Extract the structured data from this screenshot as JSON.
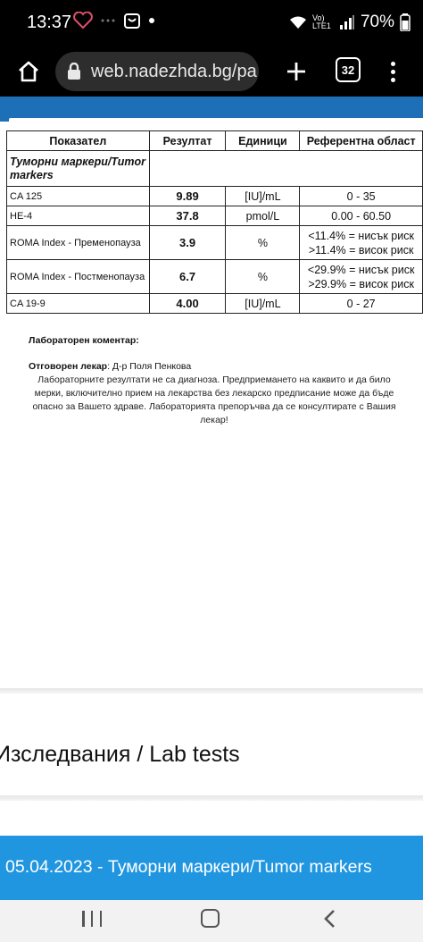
{
  "status_bar": {
    "time": "13:37",
    "battery": "70%",
    "network": "Vo) LTE1"
  },
  "browser": {
    "url": "web.nadezhda.bg/pa",
    "tab_count": "32"
  },
  "table": {
    "headers": [
      "Показател",
      "Резултат",
      "Единици",
      "Референтна област"
    ],
    "section": "Туморни маркери/Tumor markers",
    "rows": [
      {
        "name": "CA 125",
        "value": "9.89",
        "unit": "[IU]/mL",
        "ref1": "0 - 35",
        "ref2": ""
      },
      {
        "name": "HE-4",
        "value": "37.8",
        "unit": "pmol/L",
        "ref1": "0.00 - 60.50",
        "ref2": ""
      },
      {
        "name": "ROMA Index - Пременопауза",
        "value": "3.9",
        "unit": "%",
        "ref1": "<11.4% = нисък риск",
        "ref2": ">11.4% = висок риск"
      },
      {
        "name": "ROMA Index - Постменопауза",
        "value": "6.7",
        "unit": "%",
        "ref1": "<29.9% = нисък риск",
        "ref2": ">29.9% = висок риск"
      },
      {
        "name": "CA 19-9",
        "value": "4.00",
        "unit": "[IU]/mL",
        "ref1": "0 - 27",
        "ref2": ""
      }
    ]
  },
  "notes": {
    "lab_comment_label": "Лабораторен коментар:",
    "doctor_label": "Отговорен лекар",
    "doctor_name": ": Д-р Поля Пенкова",
    "disclaimer": "Лабораторните резултати не са диагноза. Предприемането на каквито и да било мерки, включително прием на лекарства без лекарско предписание може да бъде опасно за Вашето здраве. Лабораторията препоръчва да се консултирате с Вашия лекар!"
  },
  "section_title": "Изследвания / Lab tests",
  "date_bar_text": "05.04.2023 - Туморни маркери/Tumor markers",
  "colors": {
    "band_blue": "#1d6fb8",
    "date_bar_blue": "#2196e0"
  }
}
